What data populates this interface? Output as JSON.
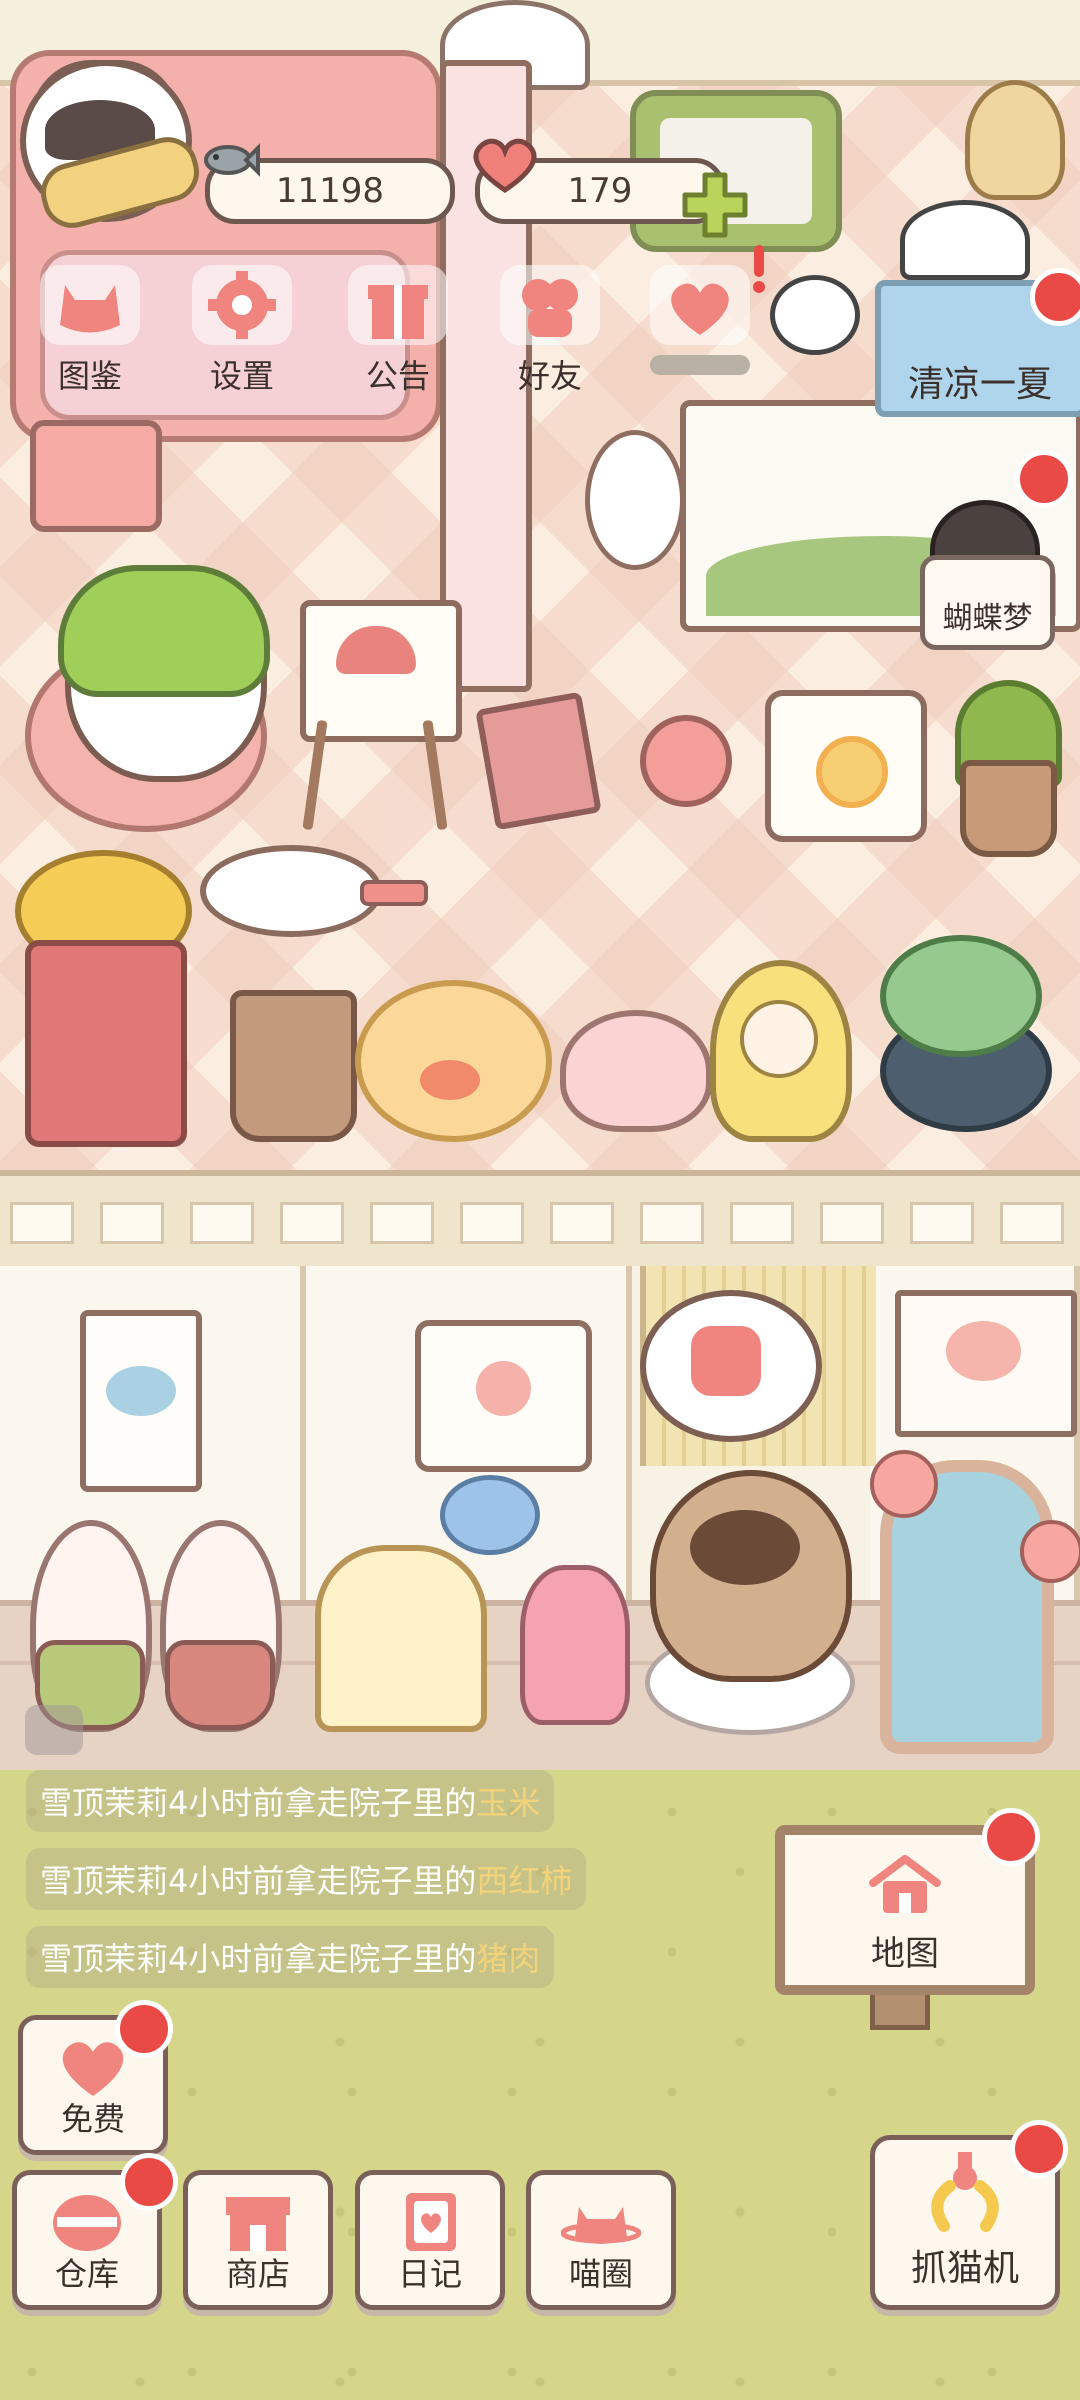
{
  "currency": {
    "fish": "11198",
    "hearts": "179"
  },
  "menu": [
    {
      "label": "图鉴",
      "icon": "cat-book-icon"
    },
    {
      "label": "设置",
      "icon": "gear-icon"
    },
    {
      "label": "公告",
      "icon": "gift-icon"
    },
    {
      "label": "好友",
      "icon": "friends-icon"
    },
    {
      "label": "",
      "icon": "mail-icon"
    }
  ],
  "event": {
    "summer_label": "清凉一夏",
    "dream_label": "蝴蝶梦"
  },
  "messages": [
    {
      "prefix": "雪顶茉莉4小时前拿走院子里的",
      "item": "玉米"
    },
    {
      "prefix": "雪顶茉莉4小时前拿走院子里的",
      "item": "西红柿"
    },
    {
      "prefix": "雪顶茉莉4小时前拿走院子里的",
      "item": "猪肉"
    }
  ],
  "bottom": {
    "free": "免费",
    "warehouse": "仓库",
    "shop": "商店",
    "diary": "日记",
    "cat_circle": "喵圈",
    "map": "地图",
    "claw_machine": "抓猫机"
  },
  "colors": {
    "accent_red": "#ea4a46",
    "button_icon": "#f0857f",
    "grass": "#d6d68a",
    "highlight_text": "#f3d37a"
  }
}
